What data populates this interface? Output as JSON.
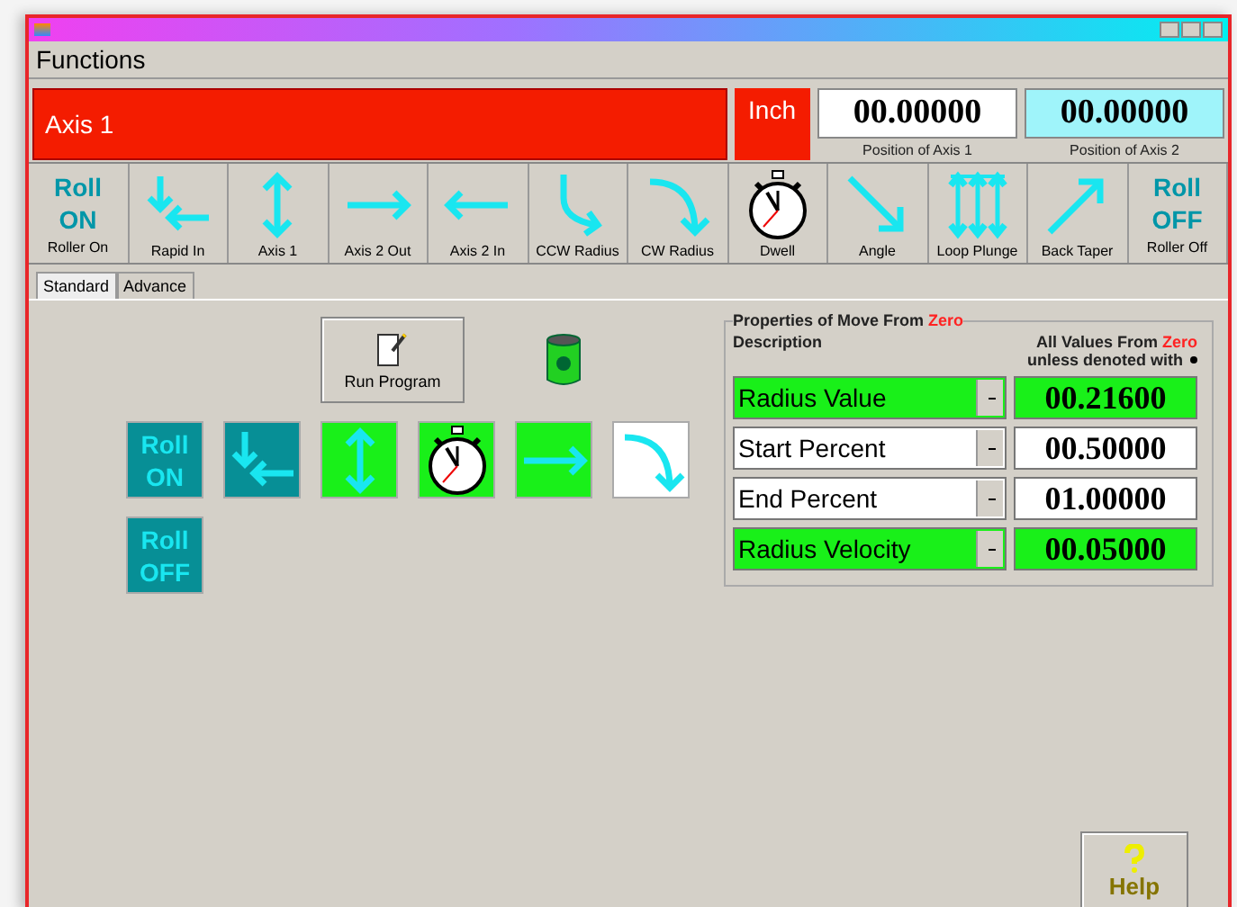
{
  "menu": [
    "Functions"
  ],
  "axis": {
    "name": "Axis 1",
    "unit": "Inch",
    "positions": [
      {
        "value": "00.00000",
        "label": "Position of Axis 1",
        "color": "#ffffff"
      },
      {
        "value": "00.00000",
        "label": "Position of Axis 2",
        "color": "#9ff4fa"
      }
    ]
  },
  "toolbar": [
    {
      "kind": "text",
      "icon_text": "Roll ON",
      "label": "Roller On"
    },
    {
      "kind": "rapid-in",
      "label": "Rapid In"
    },
    {
      "kind": "vertical",
      "label": "Axis 1"
    },
    {
      "kind": "right",
      "label": "Axis 2 Out"
    },
    {
      "kind": "left",
      "label": "Axis 2 In"
    },
    {
      "kind": "ccw",
      "label": "CCW Radius"
    },
    {
      "kind": "cw",
      "label": "CW Radius"
    },
    {
      "kind": "dwell",
      "label": "Dwell"
    },
    {
      "kind": "angle",
      "label": "Angle"
    },
    {
      "kind": "loop",
      "label": "Loop Plunge"
    },
    {
      "kind": "taper",
      "label": "Back Taper"
    },
    {
      "kind": "text",
      "icon_text": "Roll OFF",
      "label": "Roller Off"
    }
  ],
  "tabs": [
    {
      "label": "Standard",
      "selected": true
    },
    {
      "label": "Advance",
      "selected": false
    }
  ],
  "run_button": "Run Program",
  "tile_rows": [
    [
      {
        "kind": "text",
        "icon_text": "Roll ON",
        "color": "#078f96"
      },
      {
        "kind": "rapid-in",
        "color": "#078f96"
      },
      {
        "kind": "vertical",
        "color": "#19f019"
      },
      {
        "kind": "dwell",
        "color": "#19f019"
      },
      {
        "kind": "right",
        "color": "#19f019"
      },
      {
        "kind": "cw",
        "color": "#ffffff"
      }
    ],
    [
      {
        "kind": "text",
        "icon_text": "Roll OFF",
        "color": "#078f96"
      }
    ]
  ],
  "properties": {
    "legend": "Properties of Move From ",
    "legend_emphasis": "Zero",
    "description": "Description",
    "note": "All Values From ",
    "note_emphasis": "Zero",
    "note_line2": "unless denoted with",
    "rows": [
      {
        "name": "Radius Value",
        "value": "00.21600",
        "color": "#19f019"
      },
      {
        "name": "Start Percent",
        "value": "00.50000",
        "color": "#ffffff"
      },
      {
        "name": "End Percent",
        "value": "01.00000",
        "color": "#ffffff"
      },
      {
        "name": "Radius Velocity",
        "value": "00.05000",
        "color": "#19f019"
      }
    ]
  },
  "help_button": "Help"
}
